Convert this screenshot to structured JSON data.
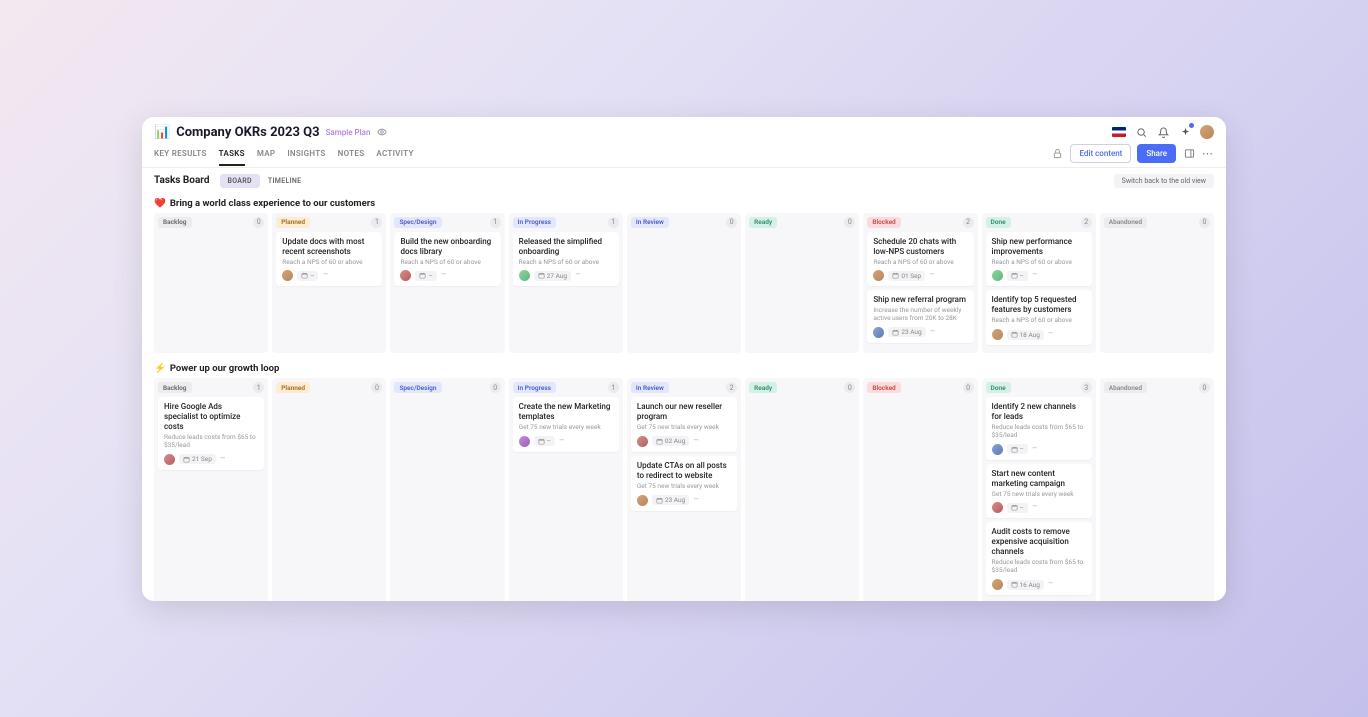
{
  "header": {
    "emoji": "📊",
    "title": "Company OKRs 2023 Q3",
    "plan": "Sample Plan"
  },
  "nav": {
    "tabs": [
      "KEY RESULTS",
      "TASKS",
      "MAP",
      "INSIGHTS",
      "NOTES",
      "ACTIVITY"
    ],
    "active": 1,
    "edit": "Edit content",
    "share": "Share"
  },
  "subheader": {
    "title": "Tasks Board",
    "views": [
      "BOARD",
      "TIMELINE"
    ],
    "active_view": 0,
    "switch": "Switch back to the old view"
  },
  "columns": [
    {
      "key": "Backlog",
      "label": "Backlog"
    },
    {
      "key": "Planned",
      "label": "Planned"
    },
    {
      "key": "SpecDesign",
      "label": "Spec/Design"
    },
    {
      "key": "InProgress",
      "label": "In Progress"
    },
    {
      "key": "InReview",
      "label": "In Review"
    },
    {
      "key": "Ready",
      "label": "Ready"
    },
    {
      "key": "Blocked",
      "label": "Blocked"
    },
    {
      "key": "Done",
      "label": "Done"
    },
    {
      "key": "Abandoned",
      "label": "Abandoned"
    }
  ],
  "swimlanes": [
    {
      "emoji": "❤️",
      "title": "Bring a world class experience to our customers",
      "counts": [
        0,
        1,
        1,
        1,
        0,
        0,
        2,
        2,
        0
      ],
      "cards": [
        [],
        [
          {
            "title": "Update docs with most recent screenshots",
            "sub": "Reach a NPS of 60 or above",
            "avatar": 0,
            "date": "–"
          }
        ],
        [
          {
            "title": "Build the new onboarding docs library",
            "sub": "Reach a NPS of 60 or above",
            "avatar": 2,
            "date": "–"
          }
        ],
        [
          {
            "title": "Released the simplified onboarding",
            "sub": "Reach a NPS of 60 or above",
            "avatar": 3,
            "date": "27 Aug"
          }
        ],
        [],
        [],
        [
          {
            "title": "Schedule 20 chats with low-NPS customers",
            "sub": "Reach a NPS of 60 or above",
            "avatar": 0,
            "date": "01 Sep"
          },
          {
            "title": "Ship new referral program",
            "sub": "Increase the number of weekly active users from 20K to 28K",
            "avatar": 1,
            "date": "23 Aug"
          }
        ],
        [
          {
            "title": "Ship new performance improvements",
            "sub": "Reach a NPS of 60 or above",
            "avatar": 3,
            "date": "–"
          },
          {
            "title": "Identify top 5 requested features by customers",
            "sub": "Reach a NPS of 60 or above",
            "avatar": 0,
            "date": "18 Aug"
          }
        ],
        []
      ]
    },
    {
      "emoji": "⚡",
      "title": "Power up our growth loop",
      "counts": [
        1,
        0,
        0,
        1,
        2,
        0,
        0,
        3,
        0
      ],
      "cards": [
        [
          {
            "title": "Hire Google Ads specialist to optimize costs",
            "sub": "Reduce leads costs from $65 to $35/lead",
            "avatar": 2,
            "date": "21 Sep"
          }
        ],
        [],
        [],
        [
          {
            "title": "Create the new Marketing templates",
            "sub": "Get 75 new trials every week",
            "avatar": 4,
            "date": "–"
          }
        ],
        [
          {
            "title": "Launch our new reseller program",
            "sub": "Get 75 new trials every week",
            "avatar": 2,
            "date": "02 Aug"
          },
          {
            "title": "Update CTAs on all posts to redirect to website",
            "sub": "Get 75 new trials every week",
            "avatar": 0,
            "date": "23 Aug"
          }
        ],
        [],
        [],
        [
          {
            "title": "Identify 2 new channels for leads",
            "sub": "Reduce leads costs from $65 to $35/lead",
            "avatar": 1,
            "date": "–"
          },
          {
            "title": "Start new content marketing campaign",
            "sub": "Get 75 new trials every week",
            "avatar": 2,
            "date": "–"
          },
          {
            "title": "Audit costs to remove expensive acquisition channels",
            "sub": "Reduce leads costs from $65 to $35/lead",
            "avatar": 0,
            "date": "16 Aug"
          }
        ],
        []
      ]
    }
  ]
}
